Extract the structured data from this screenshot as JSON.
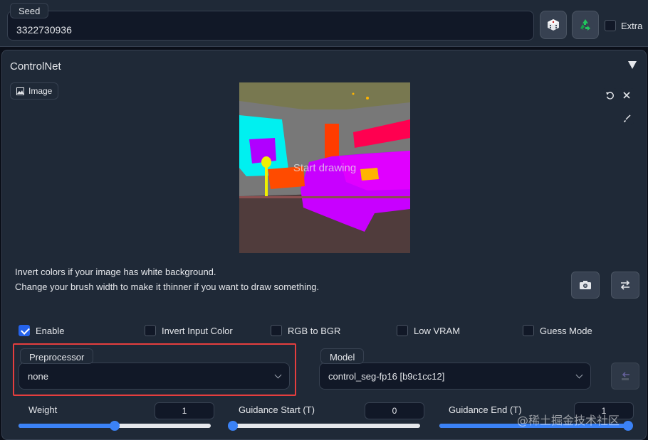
{
  "seed": {
    "label": "Seed",
    "value": "3322730936",
    "extra_label": "Extra",
    "extra_checked": false
  },
  "controlnet": {
    "title": "ControlNet",
    "image_tab_label": "Image",
    "canvas_overlay": "Start drawing",
    "hint_line1": "Invert colors if your image has white background.",
    "hint_line2": "Change your brush width to make it thinner if you want to draw something.",
    "checkboxes": [
      {
        "label": "Enable",
        "checked": true
      },
      {
        "label": "Invert Input Color",
        "checked": false
      },
      {
        "label": "RGB to BGR",
        "checked": false
      },
      {
        "label": "Low VRAM",
        "checked": false
      },
      {
        "label": "Guess Mode",
        "checked": false
      }
    ],
    "preprocessor": {
      "label": "Preprocessor",
      "value": "none"
    },
    "model": {
      "label": "Model",
      "value": "control_seg-fp16 [b9c1cc12]"
    },
    "sliders": [
      {
        "label": "Weight",
        "value": "1",
        "fraction": 0.5
      },
      {
        "label": "Guidance Start (T)",
        "value": "0",
        "fraction": 0.0
      },
      {
        "label": "Guidance End (T)",
        "value": "1",
        "fraction": 1.0
      }
    ]
  },
  "watermark": "@稀土掘金技术社区",
  "colors": {
    "accent": "#2563eb",
    "highlight_box": "#e53e3e",
    "panel": "#1f2937",
    "background": "#0b0f19"
  }
}
